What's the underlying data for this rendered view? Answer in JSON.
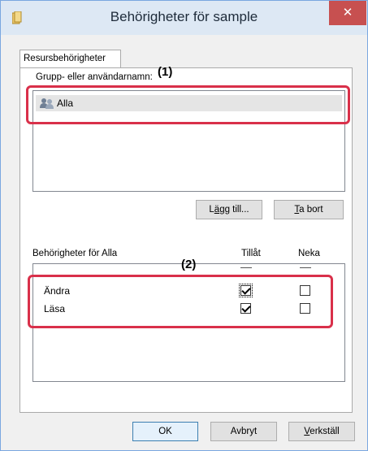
{
  "window": {
    "title": "Behörigheter för sample",
    "close_symbol": "✕"
  },
  "tabs": [
    {
      "label": "Resursbehörigheter"
    }
  ],
  "groups": {
    "label": "Grupp- eller användarnamn:",
    "items": [
      {
        "label": "Alla",
        "icon": "users-icon"
      }
    ]
  },
  "group_buttons": {
    "add_prefix": "L",
    "add_underline": "ä",
    "add_suffix": "gg till...",
    "remove_underline": "T",
    "remove_suffix": "a bort"
  },
  "permissions": {
    "label": "Behörigheter för Alla",
    "col_allow": "Tillåt",
    "col_deny": "Neka",
    "rows": [
      {
        "label": "Ändra",
        "allow": true,
        "deny": false
      },
      {
        "label": "Läsa",
        "allow": true,
        "deny": false
      }
    ]
  },
  "callouts": {
    "one": "(1)",
    "two": "(2)"
  },
  "footer_buttons": {
    "ok": "OK",
    "cancel": "Avbryt",
    "apply_underline": "V",
    "apply_suffix": "erkställ"
  },
  "colors": {
    "highlight": "#d9304a",
    "titlebar": "#dde8f4",
    "close": "#c75050"
  }
}
